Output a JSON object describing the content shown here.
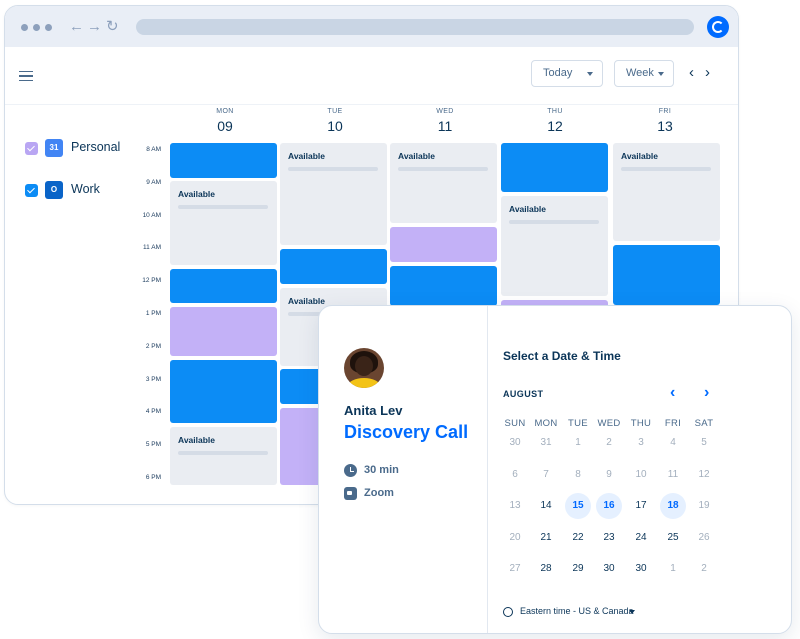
{
  "browser": {
    "back_glyph": "←",
    "forward_glyph": "→",
    "reload_glyph": "↻",
    "logo_icon": "calendly-logo"
  },
  "toolbar": {
    "menu_icon": "hamburger-menu-icon",
    "today_label": "Today",
    "view_label": "Week",
    "prev_glyph": "‹",
    "next_glyph": "›"
  },
  "calendars": [
    {
      "label": "Personal",
      "checkbox_color": "#b9a6f3",
      "app_icon": "google-calendar-icon",
      "app_text": "31",
      "app_color": "#4285f4"
    },
    {
      "label": "Work",
      "checkbox_color": "#0c8cf5",
      "app_icon": "outlook-icon",
      "app_text": "O",
      "app_color": "#0a64c8"
    }
  ],
  "week": {
    "days": [
      {
        "name": "MON",
        "num": "09"
      },
      {
        "name": "TUE",
        "num": "10"
      },
      {
        "name": "WED",
        "num": "11"
      },
      {
        "name": "THU",
        "num": "12"
      },
      {
        "name": "FRI",
        "num": "13"
      }
    ],
    "times": [
      "8 AM",
      "9 AM",
      "10 AM",
      "11 AM",
      "12 PM",
      "1 PM",
      "2 PM",
      "3 PM",
      "4 PM",
      "5 PM",
      "6 PM"
    ],
    "available_label": "Available",
    "colors": {
      "busy": "#0c8cf5",
      "personal": "#c3b1f7",
      "available": "#eaedf2"
    }
  },
  "booking": {
    "host_name": "Anita Lev",
    "event_title": "Discovery Call",
    "duration": "30 min",
    "location": "Zoom",
    "select_title": "Select a Date & Time",
    "month": "AUGUST",
    "prev_glyph": "‹",
    "next_glyph": "›",
    "weekdays": [
      "SUN",
      "MON",
      "TUE",
      "WED",
      "THU",
      "FRI",
      "SAT"
    ],
    "weeks": [
      [
        "30",
        "31",
        "1",
        "2",
        "3",
        "4",
        "5"
      ],
      [
        "6",
        "7",
        "8",
        "9",
        "10",
        "11",
        "12"
      ],
      [
        "13",
        "14",
        "15",
        "16",
        "17",
        "18",
        "19"
      ],
      [
        "20",
        "21",
        "22",
        "23",
        "24",
        "25",
        "26"
      ],
      [
        "27",
        "28",
        "29",
        "30",
        "30",
        "1",
        "2"
      ]
    ],
    "available_dates": [
      "15",
      "16",
      "18"
    ],
    "active_dates": [
      "14",
      "17",
      "21",
      "22",
      "23",
      "24",
      "25",
      "28",
      "29",
      "30"
    ],
    "timezone": "Eastern time - US & Canada",
    "accent": "#006bff"
  }
}
